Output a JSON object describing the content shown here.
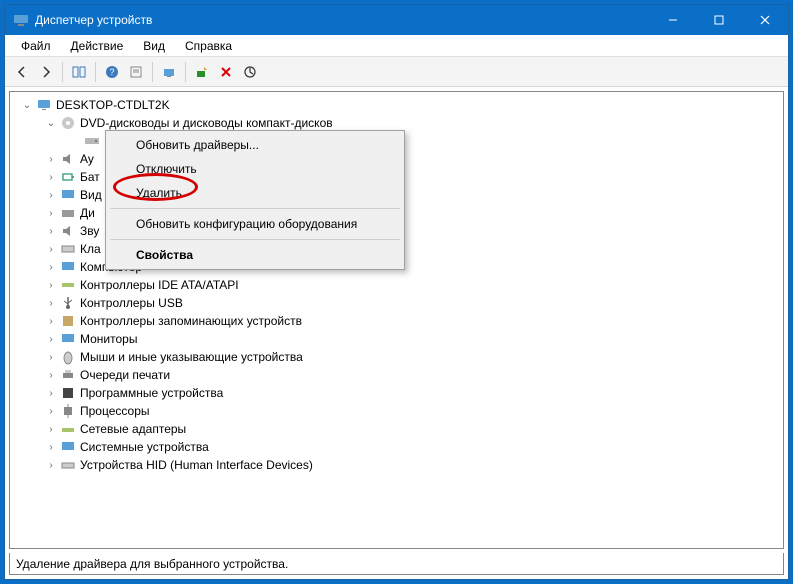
{
  "window": {
    "title": "Диспетчер устройств"
  },
  "menubar": {
    "file": "Файл",
    "action": "Действие",
    "view": "Вид",
    "help": "Справка"
  },
  "tree": {
    "root": "DESKTOP-CTDLT2K",
    "dvd": "DVD-дисководы и дисководы компакт-дисков",
    "items": {
      "audio": "Ау",
      "battery": "Бат",
      "video": "Вид",
      "disk": "Ди",
      "sound": "Зву",
      "keyboard": "Кла",
      "computer": "Компьютер",
      "ide": "Контроллеры IDE ATA/ATAPI",
      "usb": "Контроллеры USB",
      "storage": "Контроллеры запоминающих устройств",
      "monitors": "Мониторы",
      "mice": "Мыши и иные указывающие устройства",
      "print": "Очереди печати",
      "software": "Программные устройства",
      "cpu": "Процессоры",
      "network": "Сетевые адаптеры",
      "system": "Системные устройства",
      "hid": "Устройства HID (Human Interface Devices)"
    }
  },
  "context": {
    "update": "Обновить драйверы...",
    "disable": "Отключить",
    "delete": "Удалить",
    "rescan": "Обновить конфигурацию оборудования",
    "properties": "Свойства"
  },
  "status": "Удаление драйвера для выбранного устройства."
}
